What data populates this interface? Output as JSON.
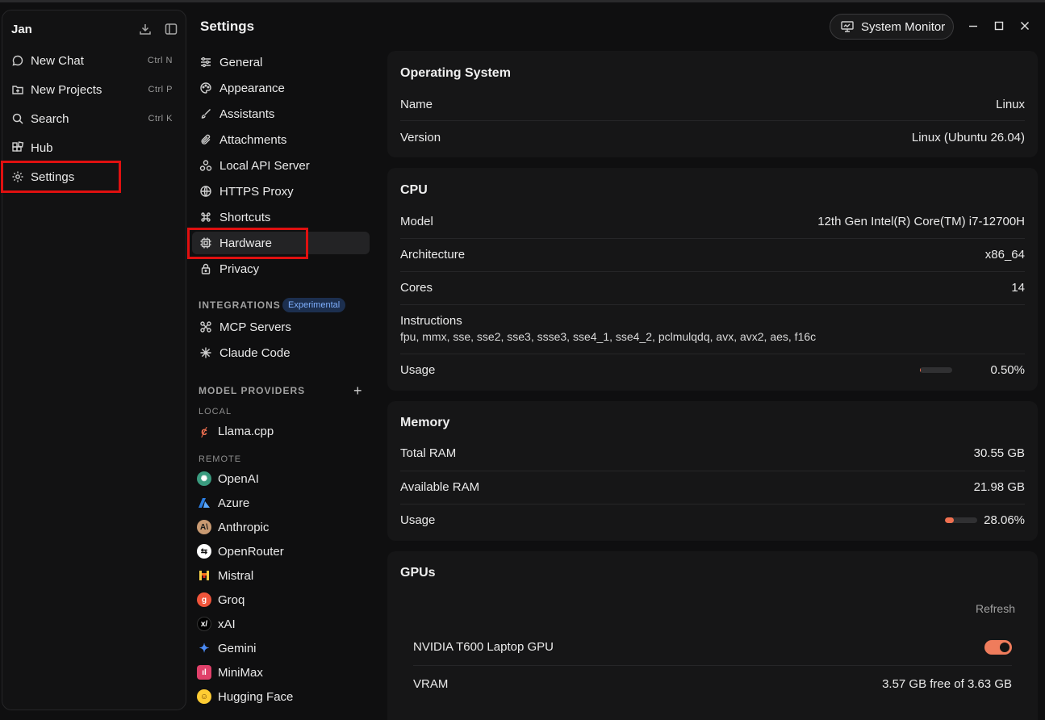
{
  "app": {
    "name": "Jan",
    "header_icons": [
      "download-icon",
      "sidebar-toggle-icon"
    ]
  },
  "sidebar": {
    "items": [
      {
        "label": "New Chat",
        "shortcut": "Ctrl N",
        "icon": "chat-bubble-icon"
      },
      {
        "label": "New Projects",
        "shortcut": "Ctrl P",
        "icon": "folder-plus-icon"
      },
      {
        "label": "Search",
        "shortcut": "Ctrl K",
        "icon": "search-icon"
      },
      {
        "label": "Hub",
        "shortcut": "",
        "icon": "hub-icon"
      },
      {
        "label": "Settings",
        "shortcut": "",
        "icon": "gear-icon"
      }
    ],
    "highlighted": "Settings"
  },
  "settings_nav": {
    "title": "Settings",
    "items": [
      {
        "label": "General",
        "icon": "sliders-icon"
      },
      {
        "label": "Appearance",
        "icon": "palette-icon"
      },
      {
        "label": "Assistants",
        "icon": "brush-icon"
      },
      {
        "label": "Attachments",
        "icon": "paperclip-icon"
      },
      {
        "label": "Local API Server",
        "icon": "server-icon"
      },
      {
        "label": "HTTPS Proxy",
        "icon": "globe-icon"
      },
      {
        "label": "Shortcuts",
        "icon": "command-icon"
      },
      {
        "label": "Hardware",
        "icon": "cpu-chip-icon",
        "active": true
      },
      {
        "label": "Privacy",
        "icon": "lock-icon"
      }
    ],
    "integrations_label": "INTEGRATIONS",
    "integrations_badge": "Experimental",
    "integrations": [
      {
        "label": "MCP Servers",
        "icon": "mcp-icon"
      },
      {
        "label": "Claude Code",
        "icon": "claude-icon"
      }
    ],
    "model_providers_label": "MODEL PROVIDERS",
    "local_label": "LOCAL",
    "local": [
      {
        "label": "Llama.cpp",
        "icon": "llamacpp-icon",
        "color": "#f07050"
      }
    ],
    "remote_label": "REMOTE",
    "remote": [
      {
        "label": "OpenAI",
        "icon": "openai-icon",
        "color": "#3a9b7f"
      },
      {
        "label": "Azure",
        "icon": "azure-icon",
        "color": "#2b7de0"
      },
      {
        "label": "Anthropic",
        "icon": "anthropic-icon",
        "color": "#c99a72"
      },
      {
        "label": "OpenRouter",
        "icon": "openrouter-icon",
        "color": "#ffffff"
      },
      {
        "label": "Mistral",
        "icon": "mistral-icon",
        "color": "#f7a21a"
      },
      {
        "label": "Groq",
        "icon": "groq-icon",
        "color": "#f0543a"
      },
      {
        "label": "xAI",
        "icon": "xai-icon",
        "color": "#000000"
      },
      {
        "label": "Gemini",
        "icon": "gemini-icon",
        "color": "#4b8bf5"
      },
      {
        "label": "MiniMax",
        "icon": "minimax-icon",
        "color": "#e0406a"
      },
      {
        "label": "Hugging Face",
        "icon": "huggingface-icon",
        "color": "#ffcc33"
      }
    ]
  },
  "topbar": {
    "system_monitor": "System Monitor"
  },
  "operating_system": {
    "title": "Operating System",
    "rows": [
      {
        "key": "Name",
        "value": "Linux"
      },
      {
        "key": "Version",
        "value": "Linux (Ubuntu 26.04)"
      }
    ]
  },
  "cpu": {
    "title": "CPU",
    "model_label": "Model",
    "model": "12th Gen Intel(R) Core(TM) i7-12700H",
    "arch_label": "Architecture",
    "arch": "x86_64",
    "cores_label": "Cores",
    "cores": "14",
    "instructions_label": "Instructions",
    "instructions": "fpu, mmx, sse, sse2, sse3, ssse3, sse4_1, sse4_2, pclmulqdq, avx, avx2, aes, f16c",
    "usage_label": "Usage",
    "usage_text": "0.50%",
    "usage_fraction": 0.005
  },
  "memory": {
    "title": "Memory",
    "total_label": "Total RAM",
    "total": "30.55 GB",
    "available_label": "Available RAM",
    "available": "21.98 GB",
    "usage_label": "Usage",
    "usage_text": "28.06%",
    "usage_fraction": 0.2806
  },
  "gpus": {
    "title": "GPUs",
    "refresh": "Refresh",
    "gpu_name": "NVIDIA T600 Laptop GPU",
    "enabled": true,
    "vram_label": "VRAM",
    "vram": "3.57 GB free of 3.63 GB"
  },
  "colors": {
    "accent": "#ef7c5c",
    "highlight_box": "#e01010",
    "badge_bg": "#1c2f4f",
    "badge_text": "#7fb0ff"
  }
}
